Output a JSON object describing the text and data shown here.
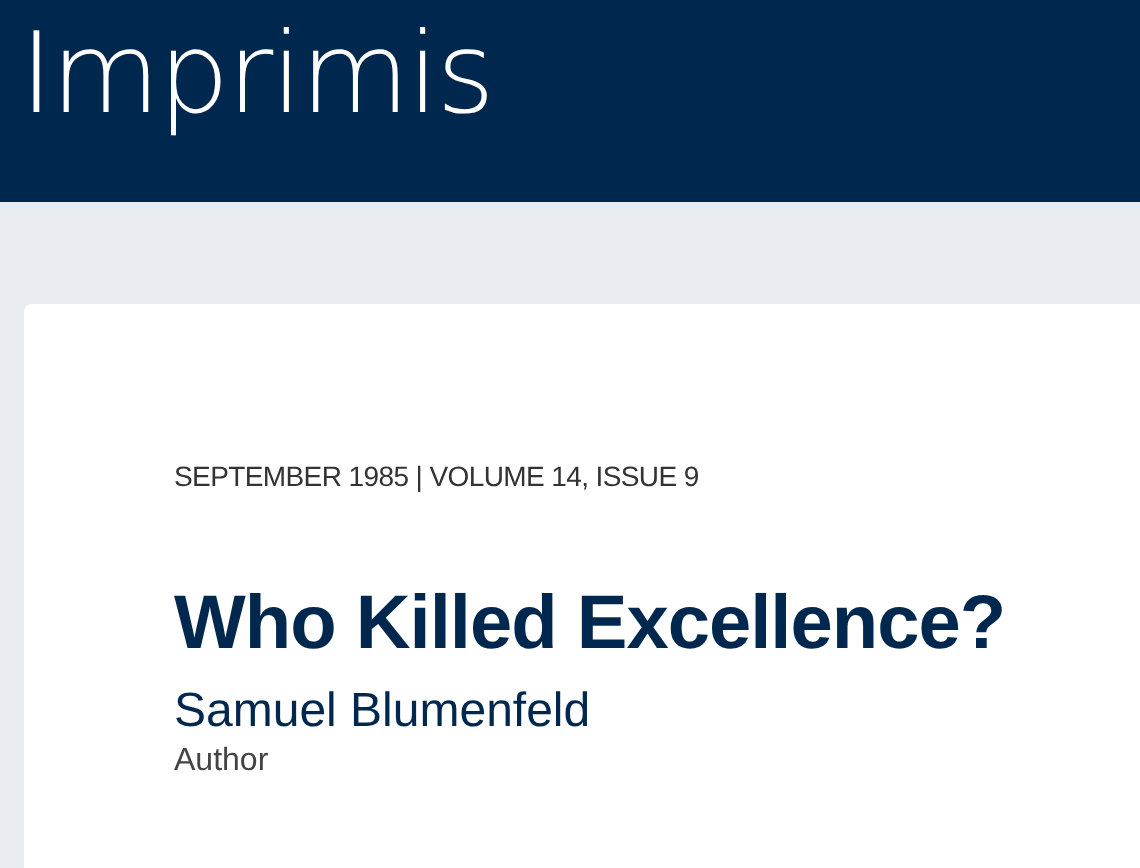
{
  "header": {
    "logo": "Imprimis"
  },
  "article": {
    "issue_line": "SEPTEMBER 1985 | VOLUME 14, ISSUE 9",
    "title": "Who Killed Excellence?",
    "author": {
      "name": "Samuel Blumenfeld",
      "role": "Author"
    }
  }
}
